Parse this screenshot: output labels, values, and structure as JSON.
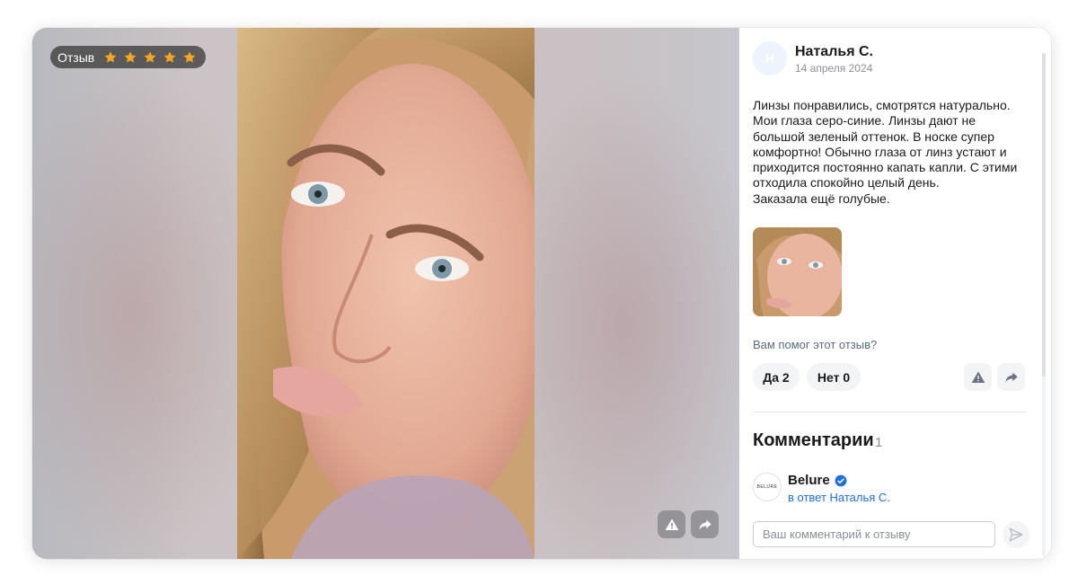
{
  "media": {
    "badge_label": "Отзыв",
    "rating": 5,
    "rating_max": 5,
    "star_color": "#f6a623",
    "buttons": [
      {
        "icon": "warning-icon"
      },
      {
        "icon": "share-icon"
      }
    ]
  },
  "review": {
    "avatar_letter": "Н",
    "author": "Наталья С.",
    "date": "14 апреля 2024",
    "text": "Линзы понравились, смотрятся натурально.\nМои глаза серо-синие. Линзы дают не\nбольшой зеленый оттенок. В носке супер\nкомфортно! Обычно глаза от линз устают и\nприходится постоянно капать капли. С этими\nотходила спокойно целый день.\nЗаказала ещё голубые."
  },
  "helpful": {
    "question": "Вам помог этот отзыв?",
    "yes": "Да 2",
    "no": "Нет 0"
  },
  "comments": {
    "title": "Комментарии",
    "count": "1",
    "items": [
      {
        "author": "Belure",
        "logo_text": "BELURE",
        "verified": true,
        "reply_to": "в ответ Наталья С."
      }
    ],
    "input_placeholder": "Ваш комментарий к отзыву"
  },
  "colors": {
    "accent_link": "#1f6fd6",
    "verified_badge": "#1f6fd6",
    "muted_text": "#8a8f99"
  }
}
